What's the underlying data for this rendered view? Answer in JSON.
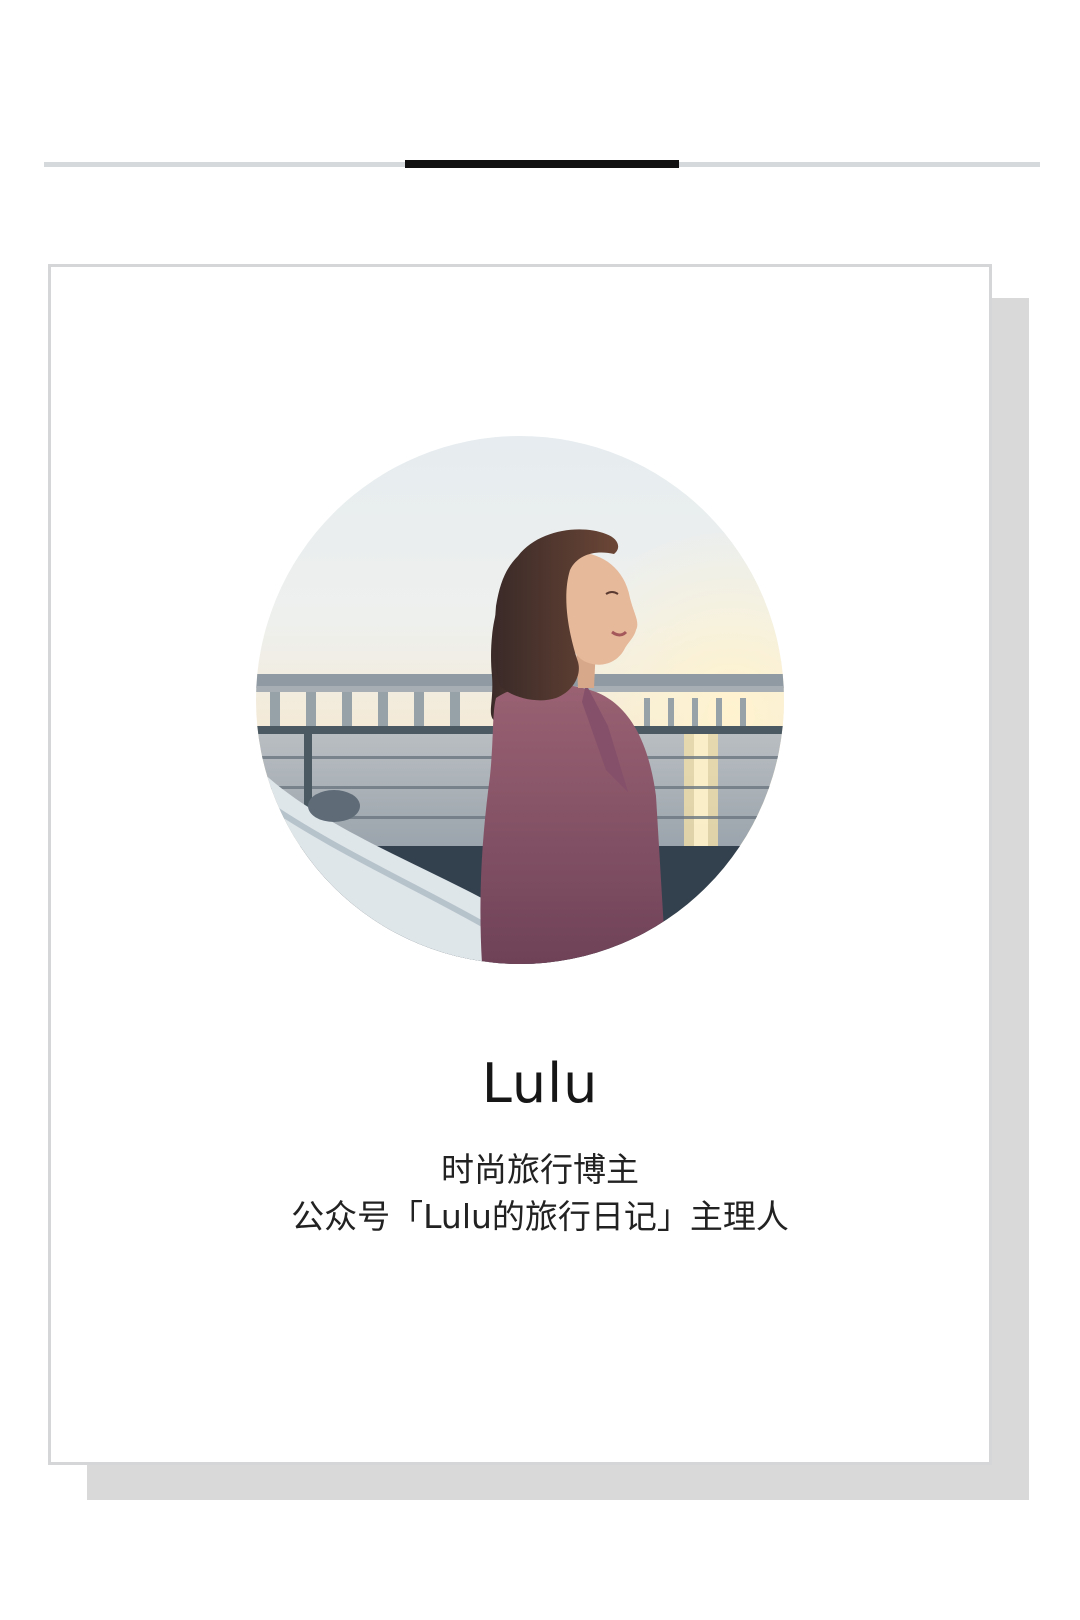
{
  "header": {
    "divider_accent_color": "#111111",
    "divider_color": "#d6d9dc"
  },
  "profile": {
    "avatar_icon": "profile-photo",
    "name": "Lulu",
    "role": "时尚旅行博主",
    "tagline": "公众号「Lulu的旅行日记」主理人"
  }
}
